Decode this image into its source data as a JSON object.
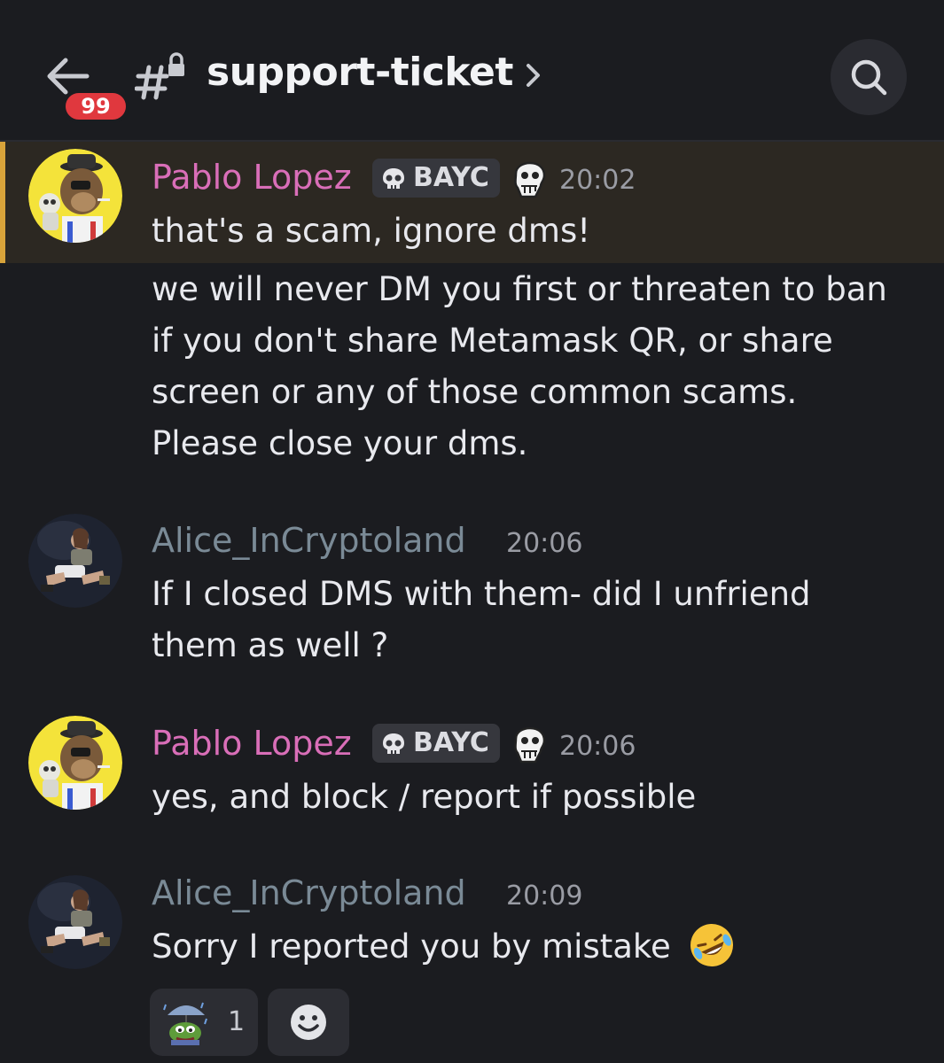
{
  "header": {
    "unread_count": "99",
    "channel_name": "support-ticket"
  },
  "messages": [
    {
      "author": "Pablo Lopez",
      "role_tag": "BAYC",
      "time": "20:02",
      "lines": [
        "that's a scam, ignore dms!"
      ],
      "highlighted": true
    },
    {
      "author": "",
      "lines": [
        "we will never DM you first or threaten to ban",
        "if you don't share Metamask QR, or share",
        "screen or any of those common scams.",
        "Please close your dms."
      ]
    },
    {
      "author": "Alice_InCryptoland",
      "time": "20:06",
      "lines": [
        "If I closed DMS with them- did I unfriend",
        "them as well ?"
      ]
    },
    {
      "author": "Pablo Lopez",
      "role_tag": "BAYC",
      "time": "20:06",
      "lines": [
        "yes, and block / report if possible"
      ]
    },
    {
      "author": "Alice_InCryptoland",
      "time": "20:09",
      "lines": [
        "Sorry I reported you by mistake"
      ],
      "inline_emoji": "rolling-on-floor-laughing",
      "reactions": [
        {
          "emoji": "pepe-rain-umbrella",
          "count": "1"
        }
      ]
    }
  ],
  "colors": {
    "background": "#1b1c20",
    "highlight": "#2c2822",
    "highlight_bar": "#d8a33a",
    "pablo_name": "#d96eb8",
    "alice_name": "#7a8a96",
    "badge": "#e0383e"
  }
}
